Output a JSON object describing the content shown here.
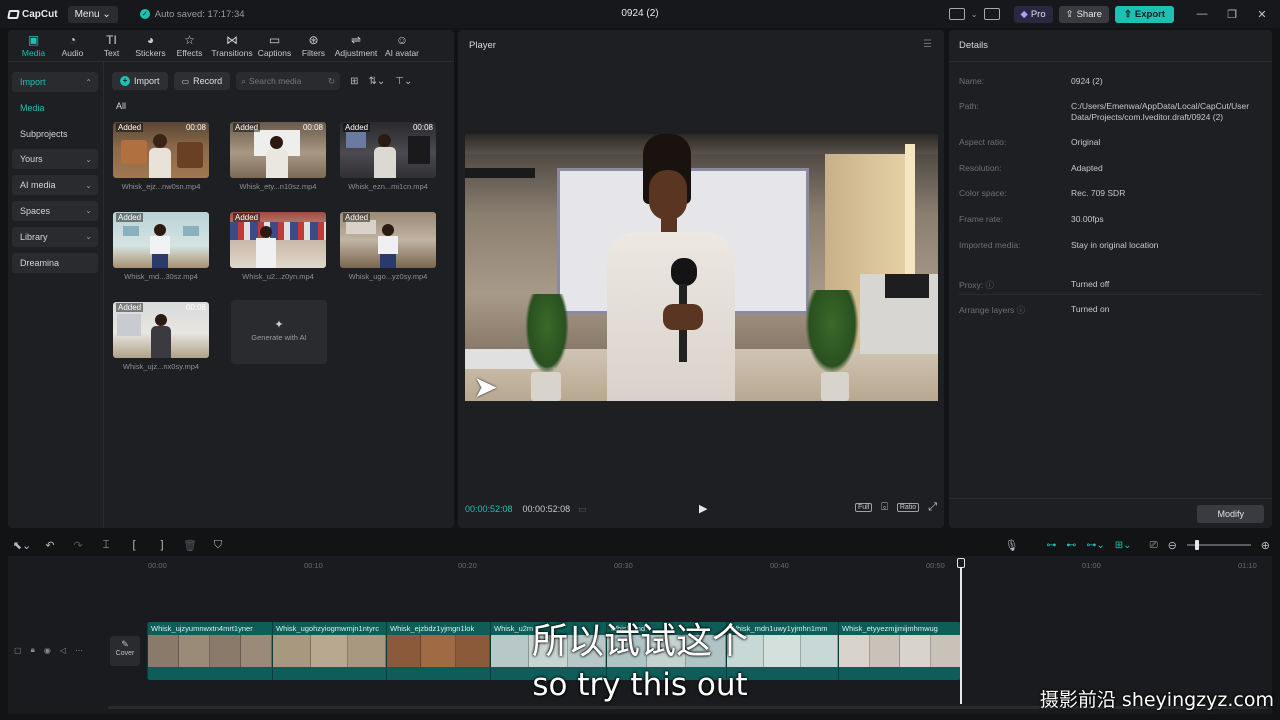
{
  "app": {
    "logo": "CapCut",
    "menu": "Menu",
    "autosave": "Auto saved: 17:17:34",
    "project_title": "0924 (2)",
    "pro": "Pro",
    "share": "Share",
    "export": "Export",
    "accent": "#1cc1b4"
  },
  "tool_tabs": [
    {
      "label": "Media",
      "icon": "media-icon"
    },
    {
      "label": "Audio",
      "icon": "audio-icon"
    },
    {
      "label": "Text",
      "icon": "text-icon"
    },
    {
      "label": "Stickers",
      "icon": "stickers-icon"
    },
    {
      "label": "Effects",
      "icon": "effects-icon"
    },
    {
      "label": "Transitions",
      "icon": "transitions-icon"
    },
    {
      "label": "Captions",
      "icon": "captions-icon"
    },
    {
      "label": "Filters",
      "icon": "filters-icon"
    },
    {
      "label": "Adjustment",
      "icon": "adjustment-icon"
    },
    {
      "label": "AI avatar",
      "icon": "ai-avatar-icon"
    }
  ],
  "sidenav": [
    {
      "label": "Import"
    },
    {
      "label": "Media"
    },
    {
      "label": "Subprojects"
    },
    {
      "label": "Yours"
    },
    {
      "label": "AI media"
    },
    {
      "label": "Spaces"
    },
    {
      "label": "Library"
    },
    {
      "label": "Dreamina"
    }
  ],
  "media_toolbar": {
    "import": "Import",
    "record": "Record",
    "search_placeholder": "Search media"
  },
  "filter_label": "All",
  "media_items": [
    {
      "name": "Whisk_ejz...nw0sn.mp4",
      "badge": "Added",
      "duration": "00:08"
    },
    {
      "name": "Whisk_ety...n10sz.mp4",
      "badge": "Added",
      "duration": "00:08"
    },
    {
      "name": "Whisk_ezn...mi1cn.mp4",
      "badge": "Added",
      "duration": "00:08"
    },
    {
      "name": "Whisk_md...30sz.mp4",
      "badge": "Added",
      "duration": ""
    },
    {
      "name": "Whisk_u2...z0yn.mp4",
      "badge": "Added",
      "duration": ""
    },
    {
      "name": "Whisk_ugo...yz0sy.mp4",
      "badge": "Added",
      "duration": ""
    },
    {
      "name": "Whisk_ujz...nx0sy.mp4",
      "badge": "Added",
      "duration": "00:08"
    }
  ],
  "generate_ai": "Generate with AI",
  "player": {
    "title": "Player",
    "current_time": "00:00:52:08",
    "total_time": "00:00:52:08",
    "full": "Full",
    "ratio": "Ratio"
  },
  "details": {
    "title": "Details",
    "rows": [
      {
        "key": "Name:",
        "value": "0924 (2)"
      },
      {
        "key": "Path:",
        "value": "C:/Users/Emenwa/AppData/Local/CapCut/User Data/Projects/com.lveditor.draft/0924 (2)"
      },
      {
        "key": "Aspect ratio:",
        "value": "Original"
      },
      {
        "key": "Resolution:",
        "value": "Adapted"
      },
      {
        "key": "Color space:",
        "value": "Rec. 709 SDR"
      },
      {
        "key": "Frame rate:",
        "value": "30.00fps"
      },
      {
        "key": "Imported media:",
        "value": "Stay in original location"
      },
      {
        "key": "Proxy:",
        "value": "Turned off"
      },
      {
        "key": "Arrange layers",
        "value": "Turned on"
      }
    ],
    "modify": "Modify"
  },
  "timeline": {
    "ticks": [
      "00:00",
      "00:10",
      "00:20",
      "00:30",
      "00:40",
      "00:50",
      "01:00",
      "01:10"
    ],
    "cover": "Cover",
    "clips": [
      {
        "label": "Whisk_ujzyumnwxtn4mrt1yner"
      },
      {
        "label": "Whisk_ugohzyiogmwmjn1ntyrc"
      },
      {
        "label": "Whisk_ejzbdz1yjmgn1lok"
      },
      {
        "label": "Whisk_u2m"
      },
      {
        "label": "Whisk_md"
      },
      {
        "label": "Whisk_mdn1uwy1yjmhn1mm"
      },
      {
        "label": "Whisk_etyyezmjjmijmhmwug"
      }
    ]
  },
  "subtitles": {
    "zh": "所以试试这个",
    "en": "so try this out"
  },
  "watermark": "摄影前沿 sheyingzyz.com"
}
